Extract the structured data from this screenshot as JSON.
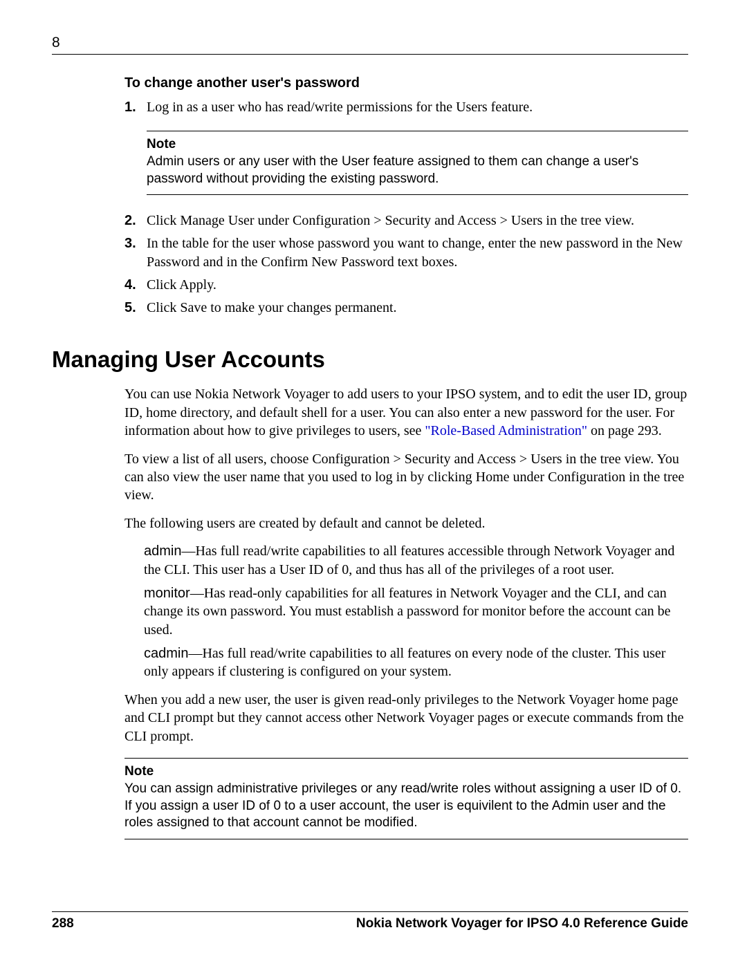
{
  "header": {
    "chapter": "8"
  },
  "section1": {
    "heading": "To change another user's password",
    "steps": [
      {
        "n": "1.",
        "t": "Log in as a user who has read/write permissions for the Users feature."
      },
      {
        "n": "2.",
        "t": "Click Manage User under Configuration >  Security and Access > Users in the tree view."
      },
      {
        "n": "3.",
        "t": "In the table for the user whose password you want to change, enter the new password in the New Password and in the Confirm New Password text boxes."
      },
      {
        "n": "4.",
        "t": "Click Apply."
      },
      {
        "n": "5.",
        "t": "Click Save to make your changes permanent."
      }
    ],
    "note_label": "Note",
    "note_body": "Admin users or any user with the User feature assigned to them can change a user's password without providing the existing password."
  },
  "section2": {
    "heading": "Managing User Accounts",
    "p1a": "You can use Nokia Network Voyager to add users to your IPSO system, and to edit the user ID, group ID, home directory, and default shell for a user. You can also enter a new password for the user. For information about how to give privileges to users, see ",
    "p1_link": "\"Role-Based Administration\"",
    "p1b": " on page 293.",
    "p2": "To view a list of all users, choose Configuration >  Security and Access > Users in the tree view. You can also view the user name that you used to log in by clicking Home under Configuration in the tree view.",
    "p3": "The following users are created by default and cannot be deleted.",
    "defs": [
      {
        "term": "admin",
        "desc": "—Has full read/write capabilities to all features accessible through Network Voyager and the CLI. This user has a User ID of 0, and thus has all of the privileges of a root user."
      },
      {
        "term": "monitor",
        "desc": "—Has read-only capabilities for all features in Network Voyager and the CLI, and can change its own password. You must establish a password for monitor before the account can be used."
      },
      {
        "term": "cadmin",
        "desc": "—Has full read/write capabilities to all features on every node of the cluster. This user only appears if clustering is configured on your system."
      }
    ],
    "p4": "When you add a new user, the user is given read-only privileges to the Network Voyager home page and CLI prompt but they cannot access other Network Voyager pages or execute commands from the CLI prompt.",
    "note2_label": "Note",
    "note2_body": "You can assign administrative privileges or any read/write roles without assigning a user ID of 0. If you assign a user ID of 0 to a user account, the user is equivilent to the Admin user and the roles assigned to that account cannot be modified."
  },
  "footer": {
    "page": "288",
    "title": "Nokia Network Voyager for IPSO 4.0 Reference Guide"
  }
}
